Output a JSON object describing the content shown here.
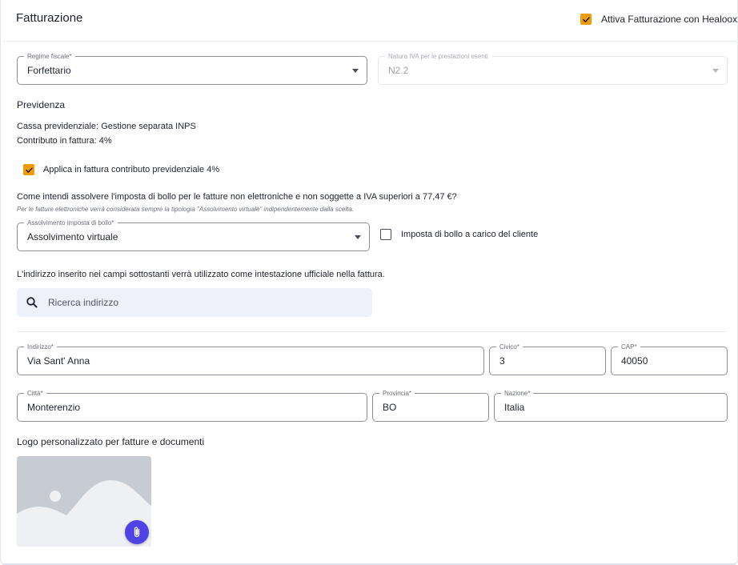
{
  "header": {
    "title": "Fatturazione",
    "enable_label": "Attiva Fatturazione con Healoox",
    "enable_checked": true
  },
  "fiscal": {
    "regime_label": "Regime fiscale*",
    "regime_value": "Forfettario",
    "natura_label": "Natura IVA per le prestazioni esenti",
    "natura_value": "N2.2"
  },
  "previdenza": {
    "title": "Previdenza",
    "cassa_label": "Cassa previdenziale:",
    "cassa_value": "Gestione separata INPS",
    "contributo_label": "Contributo in fattura:",
    "contributo_value": "4%",
    "apply_label": "Applica in fattura contributo previdenziale 4%",
    "apply_checked": true
  },
  "bollo": {
    "question": "Come intendi assolvere l'imposta di bollo per le fatture non elettroniche e non soggette a IVA superiori a 77,47 €?",
    "note": "Per le fatture elettroniche verrà considerata sempre la tipologia \"Assolvimento virtuale\" indipendentemente dalla scelta.",
    "field_label": "Assolvimento imposta di bollo*",
    "field_value": "Assolvimento virtuale",
    "cliente_label": "Imposta di bollo a carico del cliente",
    "cliente_checked": false
  },
  "address": {
    "intro": "L'indirizzo inserito nei campi sottostanti verrà utilizzato come intestazione ufficiale nella fattura.",
    "search_placeholder": "Ricerca indirizzo",
    "indirizzo_label": "Indirizzo*",
    "indirizzo_value": "Via Sant' Anna",
    "civico_label": "Civico*",
    "civico_value": "3",
    "cap_label": "CAP*",
    "cap_value": "40050",
    "citta_label": "Città*",
    "citta_value": "Monterenzio",
    "provincia_label": "Provincia*",
    "provincia_value": "BO",
    "nazione_label": "Nazione*",
    "nazione_value": "Italia"
  },
  "logo": {
    "title": "Logo personalizzato per fatture e documenti"
  },
  "icons": {
    "check": "check-icon",
    "search": "search-icon",
    "attach": "paperclip-icon",
    "placeholder": "image-placeholder-icon"
  },
  "colors": {
    "accent_orange": "#f29b09",
    "accent_purple": "#4f43e6",
    "search_bg": "#eef1fb"
  }
}
